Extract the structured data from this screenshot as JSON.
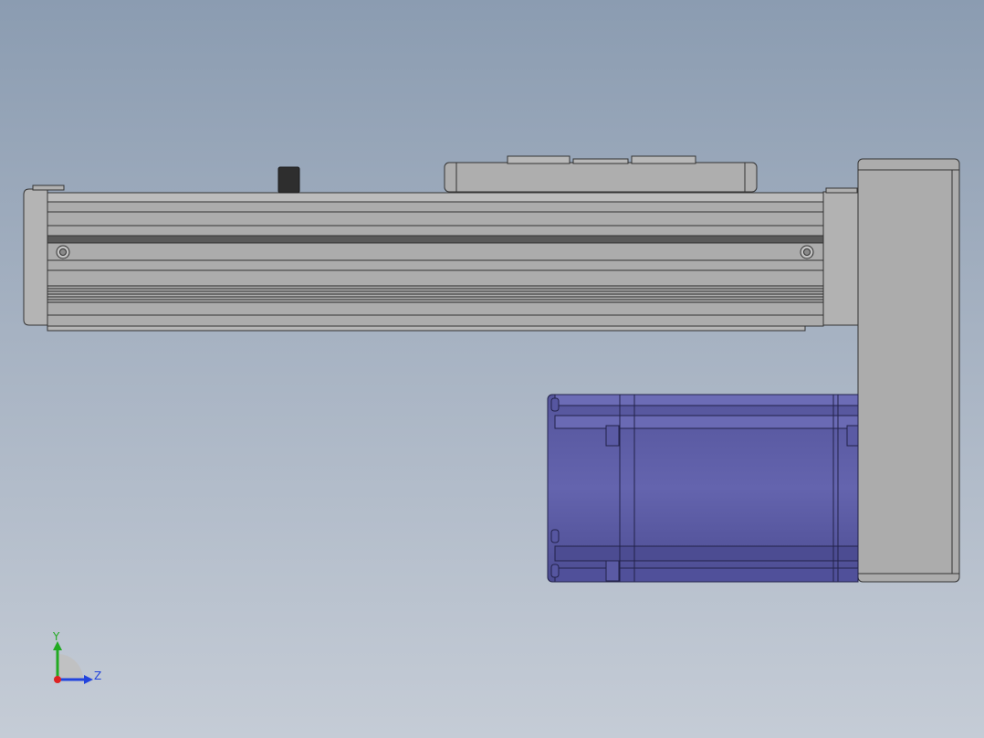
{
  "viewport": {
    "background_top": "#8b9cb1",
    "background_bottom": "#c5ccd6"
  },
  "model": {
    "rail_color": "#aaaaaa",
    "motor_color": "#5c5ca6",
    "outline_color": "#333333"
  },
  "triad": {
    "y_label": "Y",
    "z_label": "Z",
    "y_color": "#22aa22",
    "z_color": "#2244dd",
    "x_color": "#dd2222"
  }
}
